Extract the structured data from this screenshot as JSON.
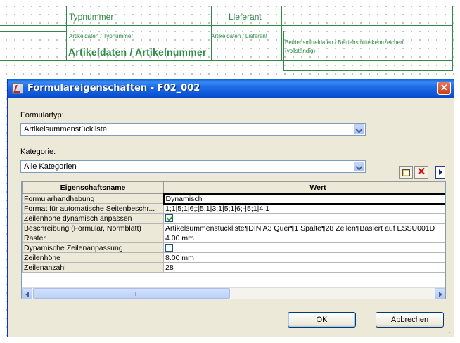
{
  "background": {
    "typnummer_label": "Typnummer",
    "lieferant_label": "Lieferant",
    "artikeldaten_typnummer_small": "Artikeldaten / Typnummer",
    "artikeldaten_artikelnummer": "Artikeldaten / Artikelnummer",
    "artikeldaten_lieferant_small": "Artikeldaten / Lieferant",
    "betriebsmitteldaten": "Betriebsmitteldaten / Betriebsmittelkennzeichen",
    "vollstaendig": "(vollständig)"
  },
  "dialog": {
    "title": "Formulareigenschaften - F02_002",
    "close_glyph": "✕",
    "formulartyp_label": "Formulartyp:",
    "formulartyp_value": "Artikelsummenstückliste",
    "kategorie_label": "Kategorie:",
    "kategorie_value": "Alle Kategorien",
    "delete_glyph": "✕",
    "ok_label": "OK",
    "cancel_label": "Abbrechen"
  },
  "grid": {
    "headers": [
      "Eigenschaftsname",
      "Wert"
    ],
    "rows": [
      {
        "name": "Formularhandhabung",
        "value": "Dynamisch",
        "type": "text",
        "active": true
      },
      {
        "name": "Format für automatische Seitenbeschr...",
        "value": "1;1|5;1|6;:|5;1|3;1|5;1|6;-|5;1|4;1",
        "type": "text"
      },
      {
        "name": "Zeilenhöhe dynamisch anpassen",
        "checked": true,
        "type": "checkbox"
      },
      {
        "name": "Beschreibung (Formular, Normblatt)",
        "value": "Artikelsummenstückliste¶DIN A3 Quer¶1 Spalte¶28 Zeilen¶Basiert auf ESSU001D",
        "type": "text"
      },
      {
        "name": "Raster",
        "value": "4.00 mm",
        "type": "text"
      },
      {
        "name": "Dynamische Zeilenanpassung",
        "checked": false,
        "type": "checkbox"
      },
      {
        "name": "Zeilenhöhe",
        "value": "8.00 mm",
        "type": "text"
      },
      {
        "name": "Zeilenanzahl",
        "value": "28",
        "type": "text"
      }
    ]
  },
  "icons": {
    "app": "form-properties-icon",
    "new_row": "new-row-icon",
    "delete": "delete-icon",
    "more": "arrow-right-icon"
  }
}
